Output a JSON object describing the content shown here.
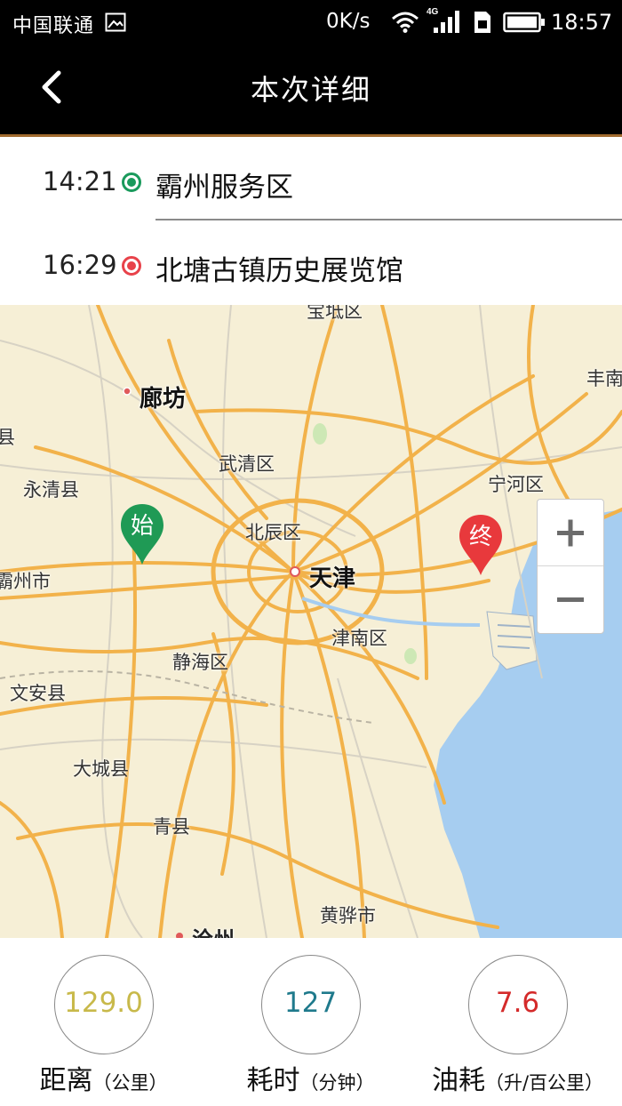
{
  "status_bar": {
    "carrier": "中国联通",
    "network_speed": "0K/s",
    "network_type": "4G",
    "time": "18:57",
    "icons": [
      "gallery-icon",
      "wifi-icon",
      "signal-icon",
      "sim-icon",
      "battery-icon"
    ]
  },
  "header": {
    "title": "本次详细",
    "back_icon": "chevron-left-icon"
  },
  "route": {
    "start": {
      "time": "14:21",
      "place": "霸州服务区",
      "color": "#1a9a5c"
    },
    "end": {
      "time": "16:29",
      "place": "北塘古镇历史展览馆",
      "color": "#e8424a"
    }
  },
  "map": {
    "labels": [
      "宝坻区",
      "廊坊",
      "丰南",
      "县",
      "武清区",
      "永清县",
      "宁河区",
      "北辰区",
      "天津",
      "霸州市",
      "津南区",
      "静海区",
      "文安县",
      "大城县",
      "青县",
      "黄骅市",
      "沧州"
    ],
    "start_marker": "始",
    "end_marker": "终",
    "zoom_in_icon": "plus-icon",
    "zoom_out_icon": "minus-icon",
    "colors": {
      "land": "#f6efd6",
      "sea": "#a6cdf0",
      "road": "#f2b24a",
      "marker_start": "#1f9a55",
      "marker_end": "#e8393c"
    }
  },
  "stats": [
    {
      "value": "129.0",
      "label": "距离",
      "unit": "（公里）",
      "color": "#c8b94a"
    },
    {
      "value": "127",
      "label": "耗时",
      "unit": "（分钟）",
      "color": "#1f7a8c"
    },
    {
      "value": "7.6",
      "label": "油耗",
      "unit": "（升/百公里）",
      "color": "#d42a2a"
    }
  ]
}
